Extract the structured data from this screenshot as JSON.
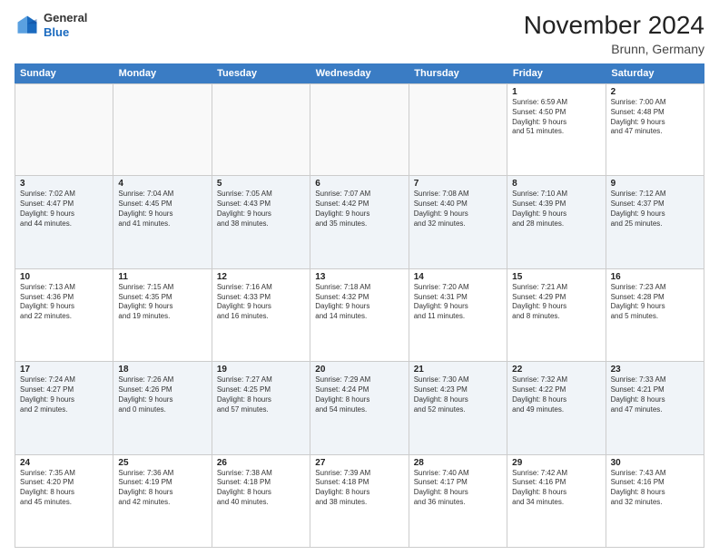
{
  "logo": {
    "general": "General",
    "blue": "Blue"
  },
  "title": "November 2024",
  "location": "Brunn, Germany",
  "header": {
    "days": [
      "Sunday",
      "Monday",
      "Tuesday",
      "Wednesday",
      "Thursday",
      "Friday",
      "Saturday"
    ]
  },
  "rows": [
    {
      "cells": [
        {
          "day": "",
          "empty": true
        },
        {
          "day": "",
          "empty": true
        },
        {
          "day": "",
          "empty": true
        },
        {
          "day": "",
          "empty": true
        },
        {
          "day": "",
          "empty": true
        },
        {
          "day": "1",
          "info": "Sunrise: 6:59 AM\nSunset: 4:50 PM\nDaylight: 9 hours\nand 51 minutes."
        },
        {
          "day": "2",
          "info": "Sunrise: 7:00 AM\nSunset: 4:48 PM\nDaylight: 9 hours\nand 47 minutes."
        }
      ]
    },
    {
      "cells": [
        {
          "day": "3",
          "info": "Sunrise: 7:02 AM\nSunset: 4:47 PM\nDaylight: 9 hours\nand 44 minutes."
        },
        {
          "day": "4",
          "info": "Sunrise: 7:04 AM\nSunset: 4:45 PM\nDaylight: 9 hours\nand 41 minutes."
        },
        {
          "day": "5",
          "info": "Sunrise: 7:05 AM\nSunset: 4:43 PM\nDaylight: 9 hours\nand 38 minutes."
        },
        {
          "day": "6",
          "info": "Sunrise: 7:07 AM\nSunset: 4:42 PM\nDaylight: 9 hours\nand 35 minutes."
        },
        {
          "day": "7",
          "info": "Sunrise: 7:08 AM\nSunset: 4:40 PM\nDaylight: 9 hours\nand 32 minutes."
        },
        {
          "day": "8",
          "info": "Sunrise: 7:10 AM\nSunset: 4:39 PM\nDaylight: 9 hours\nand 28 minutes."
        },
        {
          "day": "9",
          "info": "Sunrise: 7:12 AM\nSunset: 4:37 PM\nDaylight: 9 hours\nand 25 minutes."
        }
      ]
    },
    {
      "cells": [
        {
          "day": "10",
          "info": "Sunrise: 7:13 AM\nSunset: 4:36 PM\nDaylight: 9 hours\nand 22 minutes."
        },
        {
          "day": "11",
          "info": "Sunrise: 7:15 AM\nSunset: 4:35 PM\nDaylight: 9 hours\nand 19 minutes."
        },
        {
          "day": "12",
          "info": "Sunrise: 7:16 AM\nSunset: 4:33 PM\nDaylight: 9 hours\nand 16 minutes."
        },
        {
          "day": "13",
          "info": "Sunrise: 7:18 AM\nSunset: 4:32 PM\nDaylight: 9 hours\nand 14 minutes."
        },
        {
          "day": "14",
          "info": "Sunrise: 7:20 AM\nSunset: 4:31 PM\nDaylight: 9 hours\nand 11 minutes."
        },
        {
          "day": "15",
          "info": "Sunrise: 7:21 AM\nSunset: 4:29 PM\nDaylight: 9 hours\nand 8 minutes."
        },
        {
          "day": "16",
          "info": "Sunrise: 7:23 AM\nSunset: 4:28 PM\nDaylight: 9 hours\nand 5 minutes."
        }
      ]
    },
    {
      "cells": [
        {
          "day": "17",
          "info": "Sunrise: 7:24 AM\nSunset: 4:27 PM\nDaylight: 9 hours\nand 2 minutes."
        },
        {
          "day": "18",
          "info": "Sunrise: 7:26 AM\nSunset: 4:26 PM\nDaylight: 9 hours\nand 0 minutes."
        },
        {
          "day": "19",
          "info": "Sunrise: 7:27 AM\nSunset: 4:25 PM\nDaylight: 8 hours\nand 57 minutes."
        },
        {
          "day": "20",
          "info": "Sunrise: 7:29 AM\nSunset: 4:24 PM\nDaylight: 8 hours\nand 54 minutes."
        },
        {
          "day": "21",
          "info": "Sunrise: 7:30 AM\nSunset: 4:23 PM\nDaylight: 8 hours\nand 52 minutes."
        },
        {
          "day": "22",
          "info": "Sunrise: 7:32 AM\nSunset: 4:22 PM\nDaylight: 8 hours\nand 49 minutes."
        },
        {
          "day": "23",
          "info": "Sunrise: 7:33 AM\nSunset: 4:21 PM\nDaylight: 8 hours\nand 47 minutes."
        }
      ]
    },
    {
      "cells": [
        {
          "day": "24",
          "info": "Sunrise: 7:35 AM\nSunset: 4:20 PM\nDaylight: 8 hours\nand 45 minutes."
        },
        {
          "day": "25",
          "info": "Sunrise: 7:36 AM\nSunset: 4:19 PM\nDaylight: 8 hours\nand 42 minutes."
        },
        {
          "day": "26",
          "info": "Sunrise: 7:38 AM\nSunset: 4:18 PM\nDaylight: 8 hours\nand 40 minutes."
        },
        {
          "day": "27",
          "info": "Sunrise: 7:39 AM\nSunset: 4:18 PM\nDaylight: 8 hours\nand 38 minutes."
        },
        {
          "day": "28",
          "info": "Sunrise: 7:40 AM\nSunset: 4:17 PM\nDaylight: 8 hours\nand 36 minutes."
        },
        {
          "day": "29",
          "info": "Sunrise: 7:42 AM\nSunset: 4:16 PM\nDaylight: 8 hours\nand 34 minutes."
        },
        {
          "day": "30",
          "info": "Sunrise: 7:43 AM\nSunset: 4:16 PM\nDaylight: 8 hours\nand 32 minutes."
        }
      ]
    }
  ]
}
